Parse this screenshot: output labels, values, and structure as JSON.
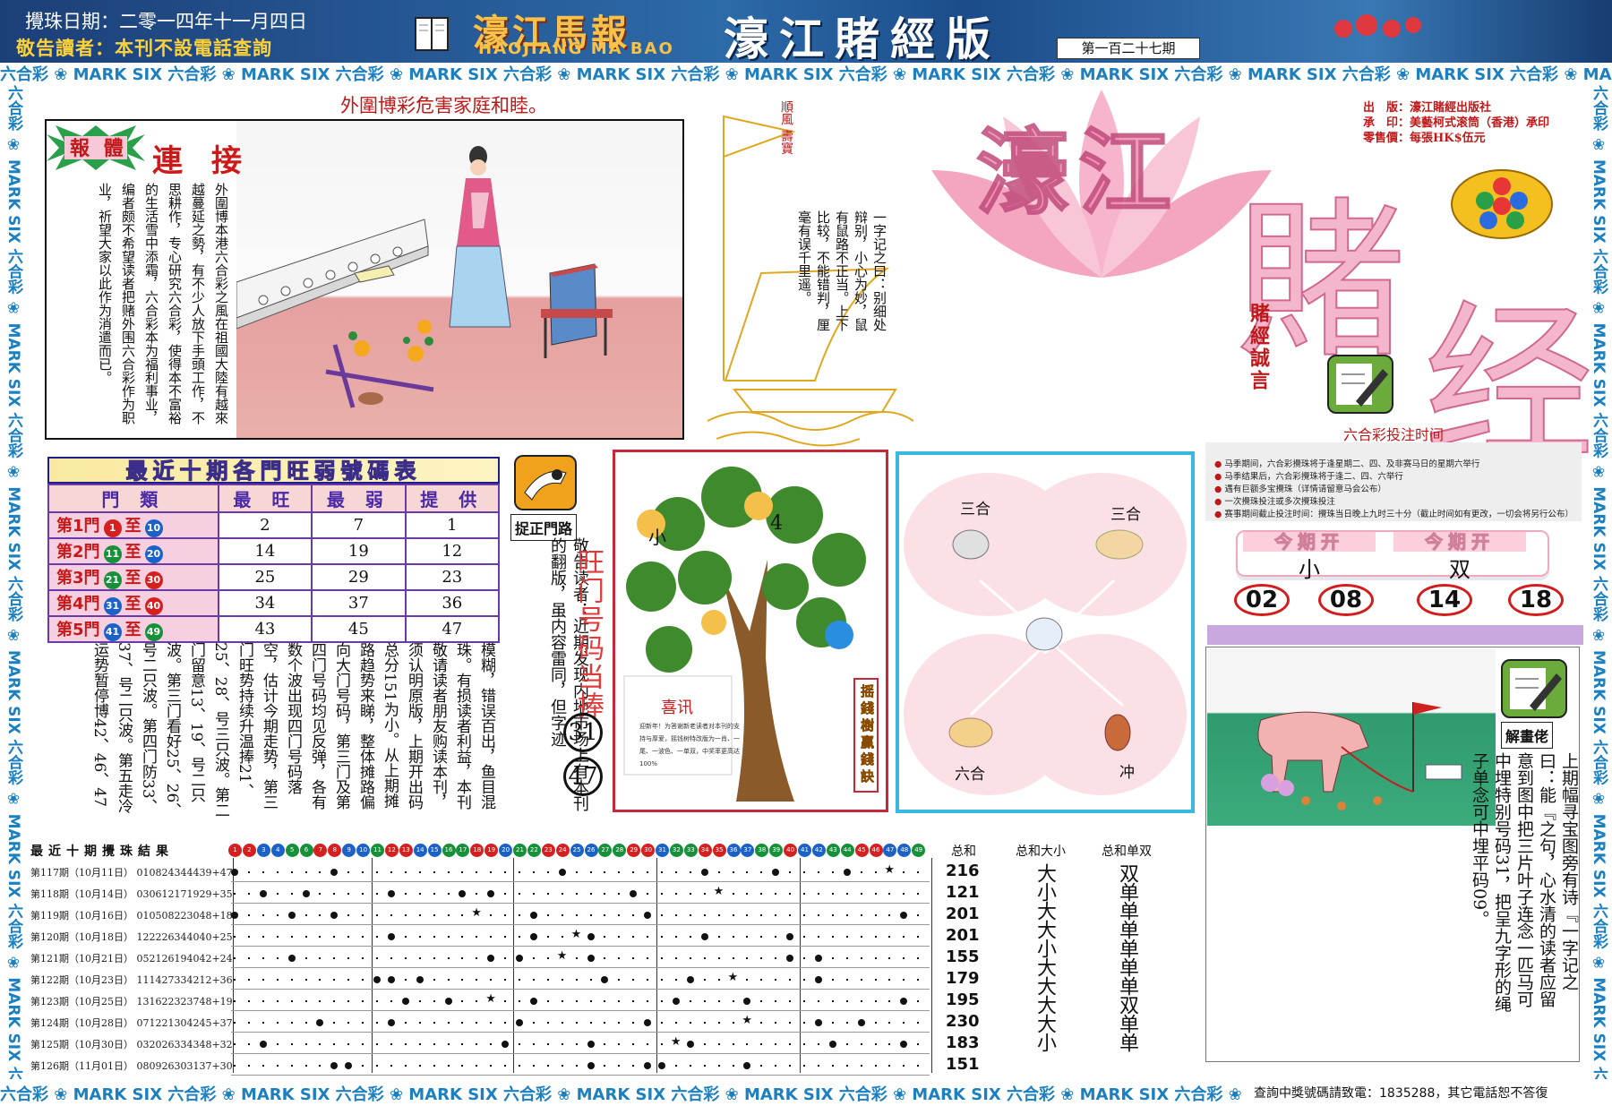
{
  "header": {
    "draw_date": "攪珠日期：二零一四年十一月四日",
    "notice": "敬告讀者：本刊不設電話查詢",
    "logo_cn": "濠江馬報",
    "logo_en": "HAOJIANG MA BAO",
    "edition_title": "濠江賭經版",
    "issue_no": "第一百二十七期"
  },
  "strip": {
    "horizontal": "六合彩 ❀ MARK SIX 六合彩 ❀ MARK SIX 六合彩 ❀ MARK SIX 六合彩 ❀ MARK SIX 六合彩 ❀ MARK SIX 六合彩 ❀ MARK SIX 六合彩 ❀ MARK SIX 六合彩 ❀ MARK SIX 六合彩 ❀ MARK SIX 六合彩 ❀ MARK SIX",
    "vertical": "六合彩 ❀ MARK SIX 六合彩 ❀ MARK SIX 六合彩 ❀ MARK SIX 六合彩 ❀ MARK SIX 六合彩 ❀ MARK SIX 六合彩 ❀ MARK SIX 六合彩 ❀ MARK SIX"
  },
  "story": {
    "slogan": "外圍博彩危害家庭和睦。",
    "badge": "報 體",
    "badge_title": "連 接",
    "text": "外圍博本港六合彩之風在祖國大陸有越來越蔓延之勢，有不少人放下手頭工作，不思耕作，专心研究六合彩，使得本不富裕的生活雪中添霜，六合彩本为福利事业，编者颇不希望读者把赌外围六合彩作为职业，祈望大家以此作为消遣而已。"
  },
  "sail": {
    "flag": "順風 壽寶",
    "text": "一字记之曰：别细处辩别，小心为妙，鼠有鼠路不正当。上下比较，不能错判，厘毫有误千里遥。"
  },
  "masthead": {
    "big1": "濠江",
    "big2": "賭",
    "big3": "经",
    "publisher": [
      "出　版：濠江賭經出版社",
      "承　印：美藝柯式滚筒（香港）承印",
      "零售價：每張HK$伍元"
    ],
    "motto": "賭經誠言"
  },
  "bet_time": {
    "title": "六合彩投注时间",
    "lines": [
      "马季期间，六合彩攪珠将于逢星期二、四、及非赛马日的星期六举行",
      "马季结果后，六合彩攪珠将于逢二、四、六举行",
      "遇有巨额多宝攪珠（详情请留意马会公布）",
      "一次攪珠投注或多次攪珠投注",
      "赛事期间截止投注时间：攪珠当日晚上九时三十分（截止时间如有更改，一切会将另行公布）"
    ]
  },
  "this_issue": {
    "label1": "今期开",
    "value1": "小",
    "label2": "今期开",
    "value2": "双",
    "numbers": [
      "02",
      "08",
      "14",
      "18"
    ]
  },
  "door_table": {
    "title": "最近十期各門旺弱號碼表",
    "headers": [
      "門 類",
      "最 旺",
      "最 弱",
      "提 供"
    ],
    "rows": [
      {
        "door": "第1門",
        "from": "1",
        "to": "10",
        "hot": "2",
        "cold": "7",
        "tip": "1"
      },
      {
        "door": "第2門",
        "from": "11",
        "to": "20",
        "hot": "14",
        "cold": "19",
        "tip": "12"
      },
      {
        "door": "第3門",
        "from": "21",
        "to": "30",
        "hot": "25",
        "cold": "29",
        "tip": "23"
      },
      {
        "door": "第4門",
        "from": "31",
        "to": "40",
        "hot": "34",
        "cold": "37",
        "tip": "36"
      },
      {
        "door": "第5門",
        "from": "41",
        "to": "49",
        "hot": "43",
        "cold": "45",
        "tip": "47"
      }
    ],
    "to_word": "至"
  },
  "catch": {
    "label": "捉正門路",
    "text": "敬告读者：近期发现内地市场上有本刊的翻版，虽内容雷同，但字迹",
    "wang_title": "旺门号码当捧",
    "num1": "31",
    "num2": "47"
  },
  "column": {
    "text": "模糊，错误百出，鱼目混珠。有损读者利益，本刊敬请读者朋友购读本刊，须认明原版，上期开出码总分151为小。从上期摊路趋势来睇，整体摊路偏向大门号码，第三门及第四门号码均见反弹，各有数个波出现四门号码落空，估计今期走势，第三门旺势持续升温捧21、25、28、号三只波。第二门留意13、19、号二只波。第三门看好25、26、号二只波。第四门防33、37、号二只波。第五走冷运势暂停博42、46、47"
  },
  "tree": {
    "xi_title": "喜讯",
    "xi_text": "迎新年！为答谢新老读者对本刊的支持与厚爱，摇钱树特改版为一肖、一尾、一波色、一单双，中奖率更高达100%",
    "side": "摇錢樹贏錢訣",
    "tag_left": "小",
    "tag_right": "4"
  },
  "zodiac": {
    "top_left": "三合",
    "top_right": "三合",
    "bottom_left": "六合",
    "bottom_right": "冲"
  },
  "puzzle": {
    "label": "解畫佬",
    "text": "上期幅寻宝图旁有诗『一字记之曰：能『之句，心水清的读者应留意到图中把三片叶子连念一匹马可中埋特别号码31，把呈九字形的绳子单念可中埋平码09。"
  },
  "results": {
    "title": "最近十期攪珠結果",
    "sum_header": "总和",
    "bs_header": "总和大小",
    "oe_header": "总和单双",
    "rows": [
      {
        "label": "第117期（10月11日）",
        "balls": [
          1,
          8,
          24,
          34,
          44,
          39
        ],
        "special": 47,
        "sum": "216"
      },
      {
        "label": "第118期（10月14日）",
        "balls": [
          3,
          6,
          12,
          17,
          19,
          29
        ],
        "special": 35,
        "sum": "121"
      },
      {
        "label": "第119期（10月16日）",
        "balls": [
          1,
          5,
          8,
          22,
          30,
          48
        ],
        "special": 18,
        "sum": "201"
      },
      {
        "label": "第120期（10月18日）",
        "balls": [
          12,
          22,
          26,
          34,
          40,
          40
        ],
        "special": 25,
        "sum": "201"
      },
      {
        "label": "第121期（10月21日）",
        "balls": [
          5,
          21,
          26,
          19,
          40,
          42
        ],
        "special": 24,
        "sum": "155"
      },
      {
        "label": "第122期（10月23日）",
        "balls": [
          11,
          14,
          27,
          33,
          42,
          12
        ],
        "special": 36,
        "sum": "179"
      },
      {
        "label": "第123期（10月25日）",
        "balls": [
          13,
          16,
          22,
          32,
          37,
          48
        ],
        "special": 19,
        "sum": "195"
      },
      {
        "label": "第124期（10月28日）",
        "balls": [
          7,
          12,
          21,
          30,
          42,
          45
        ],
        "special": 37,
        "sum": "230"
      },
      {
        "label": "第125期（10月30日）",
        "balls": [
          3,
          20,
          26,
          33,
          43,
          48
        ],
        "special": 32,
        "sum": "183"
      },
      {
        "label": "第126期（11月01日）",
        "balls": [
          8,
          9,
          26,
          30,
          31,
          37
        ],
        "special": 30,
        "sum": "151"
      }
    ],
    "big_small": "大小大大小大大大大小",
    "odd_even": "双单单单单单单双单单"
  },
  "footer": {
    "hotline": "查詢中獎號碼請致電：1835288，其它電話恕不答復"
  }
}
